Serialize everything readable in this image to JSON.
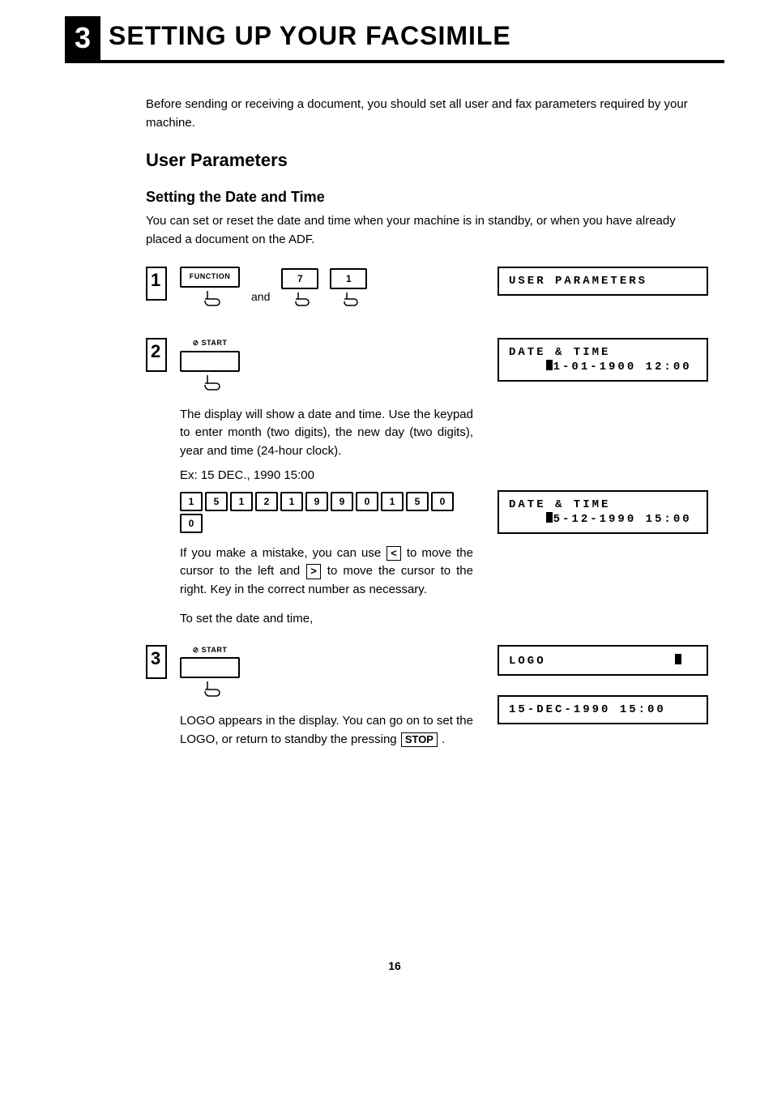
{
  "chapter": {
    "num": "3",
    "title": "SETTING UP YOUR FACSIMILE"
  },
  "intro": "Before sending or receiving a document, you should set all user and fax parameters required by your machine.",
  "heading2": "User Parameters",
  "heading3": "Setting the Date and Time",
  "date_intro": "You can set or reset the date and time when your machine is in standby, or when you have already placed a document on the ADF.",
  "keys": {
    "function": "FUNCTION",
    "start": "⊘ START",
    "seven": "7",
    "one": "1",
    "and": "and",
    "stop": "STOP",
    "lt": "<",
    "gt": ">"
  },
  "step2_text": "The display will show a date and time. Use the keypad to enter month (two digits), the new day (two digits), year and time (24-hour clock).",
  "step2_example_label": "Ex: 15 DEC., 1990 15:00",
  "step2_keyseq": [
    "1",
    "5",
    "1",
    "2",
    "1",
    "9",
    "9",
    "0",
    "1",
    "5",
    "0",
    "0"
  ],
  "step2_mistake_a": "If you make a mistake, you can use ",
  "step2_mistake_b": " to move the cursor to the left and ",
  "step2_mistake_c": " to move the cursor to the right. Key in the correct number as necessary.",
  "step2_toset": "To set the date and time,",
  "step3_text_a": "LOGO appears in the display. You can go on to set the LOGO, or return to standby the pressing ",
  "step3_text_b": " .",
  "lcd": {
    "user_params": "USER PARAMETERS",
    "dt1_l1": "DATE & TIME",
    "dt1_l2_after": "1-01-1900 12:00",
    "dt2_l1": "DATE & TIME",
    "dt2_l2_after": "5-12-1990 15:00",
    "logo": "LOGO",
    "final": "15-DEC-1990 15:00"
  },
  "page_number": "16"
}
